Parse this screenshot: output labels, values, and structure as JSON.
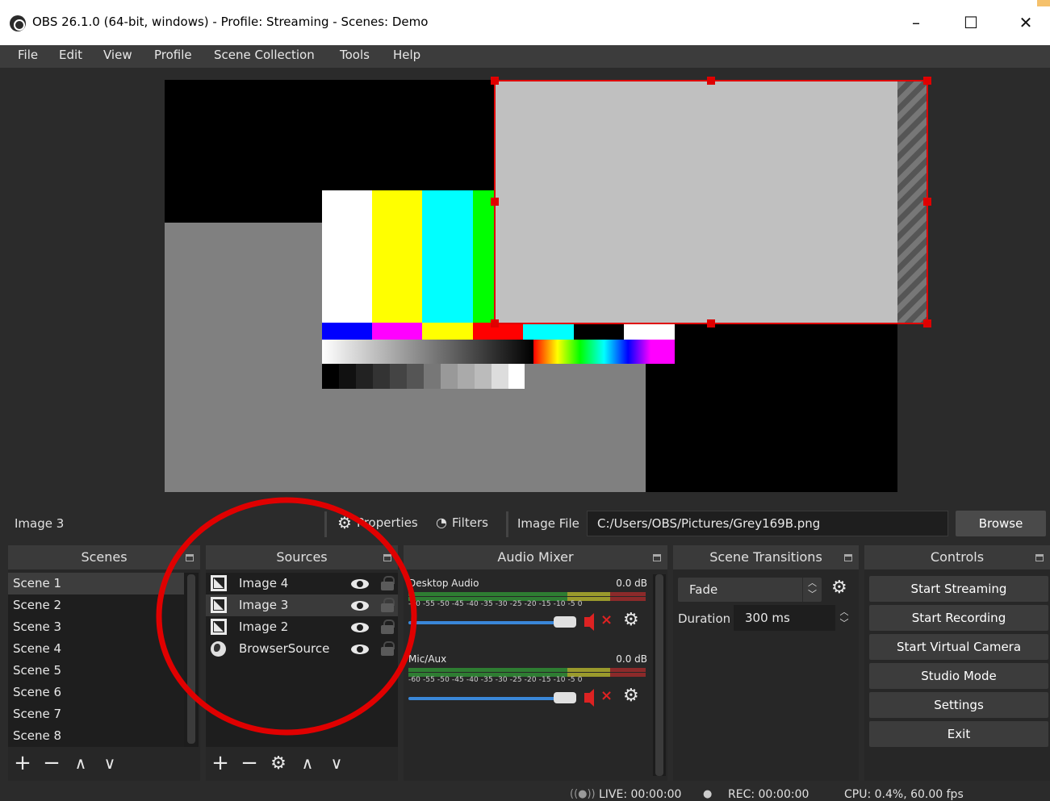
{
  "window": {
    "title": "OBS 26.1.0 (64-bit, windows) - Profile: Streaming - Scenes: Demo",
    "min": "–",
    "max": "☐",
    "close": "✕"
  },
  "menu": [
    "File",
    "Edit",
    "View",
    "Profile",
    "Scene Collection",
    "Tools",
    "Help"
  ],
  "context_bar": {
    "source_name": "Image 3",
    "properties_label": "Properties",
    "filters_label": "Filters",
    "image_file_label": "Image File",
    "image_file_path": "C:/Users/OBS/Pictures/Grey169B.png",
    "browse_label": "Browse"
  },
  "docks": {
    "scenes": {
      "title": "Scenes",
      "items": [
        "Scene 1",
        "Scene 2",
        "Scene 3",
        "Scene 4",
        "Scene 5",
        "Scene 6",
        "Scene 7",
        "Scene 8"
      ],
      "selected": "Scene 1"
    },
    "sources": {
      "title": "Sources",
      "items": [
        {
          "label": "Image 4",
          "type": "image"
        },
        {
          "label": "Image 3",
          "type": "image"
        },
        {
          "label": "Image 2",
          "type": "image"
        },
        {
          "label": "BrowserSource",
          "type": "browser"
        }
      ],
      "selected": "Image 3"
    },
    "mixer": {
      "title": "Audio Mixer",
      "channels": [
        {
          "name": "Desktop Audio",
          "db": "0.0 dB"
        },
        {
          "name": "Mic/Aux",
          "db": "0.0 dB"
        }
      ],
      "scale": "-60  -55  -50  -45  -40  -35  -30  -25  -20  -15  -10  -5   0"
    },
    "transitions": {
      "title": "Scene Transitions",
      "selected": "Fade",
      "duration_label": "Duration",
      "duration_value": "300 ms"
    },
    "controls": {
      "title": "Controls",
      "buttons": [
        "Start Streaming",
        "Start Recording",
        "Start Virtual Camera",
        "Studio Mode",
        "Settings",
        "Exit"
      ]
    }
  },
  "status": {
    "live": "LIVE: 00:00:00",
    "rec": "REC: 00:00:00",
    "cpu": "CPU: 0.4%, 60.00 fps"
  },
  "colors": {
    "selection": "#e00000",
    "accent_slider": "#3a87d8",
    "mute": "#dd2222"
  },
  "icons": {
    "add": "+",
    "remove": "−",
    "up": "∧",
    "down": "∨",
    "gear": "⚙"
  }
}
